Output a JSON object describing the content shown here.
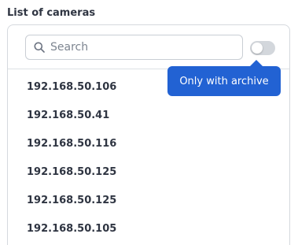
{
  "section": {
    "title": "List of cameras"
  },
  "search": {
    "placeholder": "Search",
    "value": ""
  },
  "archive_toggle": {
    "enabled": false,
    "tooltip": "Only with archive"
  },
  "cameras": [
    {
      "label": "192.168.50.106"
    },
    {
      "label": "192.168.50.41"
    },
    {
      "label": "192.168.50.116"
    },
    {
      "label": "192.168.50.125"
    },
    {
      "label": "192.168.50.125"
    },
    {
      "label": "192.168.50.105"
    }
  ],
  "colors": {
    "accent": "#2262d3",
    "text": "#2f3542",
    "border": "#d5d9de",
    "toggle_off": "#d3d7dc"
  }
}
